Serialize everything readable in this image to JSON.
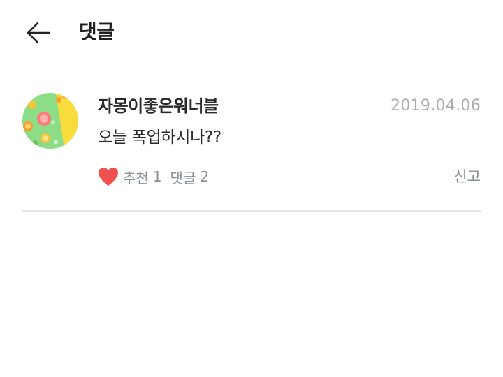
{
  "header": {
    "title": "댓글",
    "back_icon": "arrow-left-icon"
  },
  "comment": {
    "username": "자몽이좋은워너블",
    "date": "2019.04.06",
    "text": "오늘 폭업하시나??",
    "like_label": "추천",
    "like_count": "1",
    "reply_label": "댓글",
    "reply_count": "2",
    "report_label": "신고",
    "heart_icon": "heart-icon",
    "heart_color": "#f05050"
  },
  "colors": {
    "date": "#a9aeb4",
    "meta": "#8a8f95",
    "divider": "#e3e5e7"
  }
}
